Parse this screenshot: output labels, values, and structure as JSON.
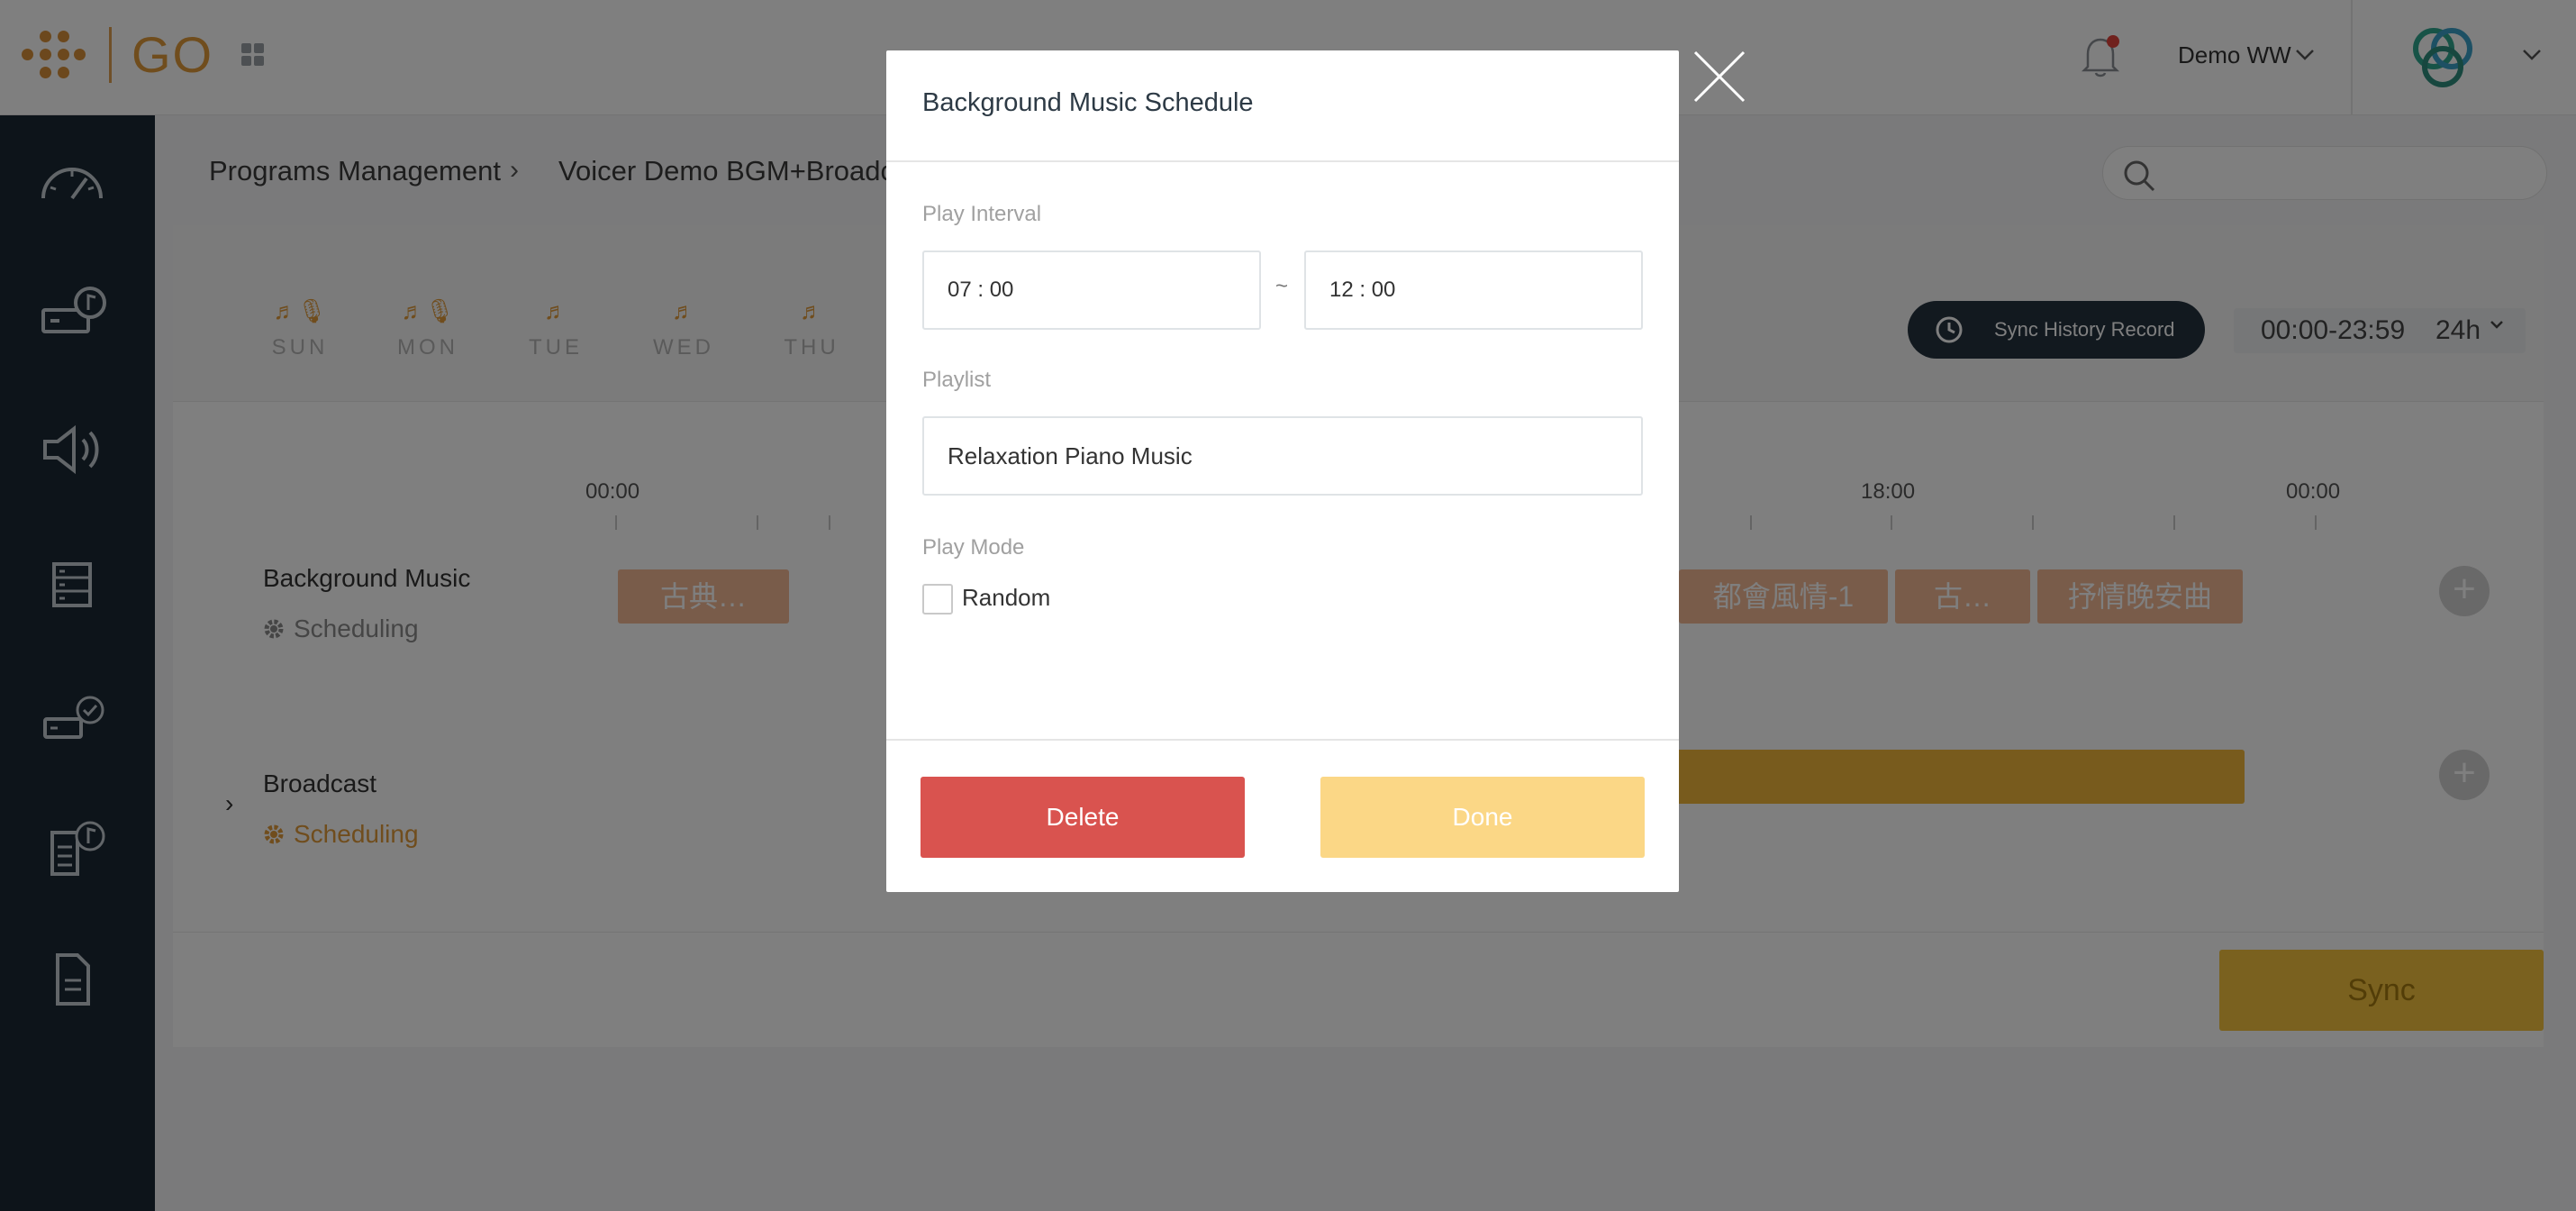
{
  "header": {
    "logo_text": "GO",
    "user_name": "Demo WW"
  },
  "breadcrumb": {
    "level1": "Programs Management",
    "level2": "Voicer Demo BGM+Broadcast"
  },
  "days": [
    {
      "label": "SUN",
      "icons": "♬🎙"
    },
    {
      "label": "MON",
      "icons": "♬🎙"
    },
    {
      "label": "TUE",
      "icons": "♬"
    },
    {
      "label": "WED",
      "icons": "♬"
    },
    {
      "label": "THU",
      "icons": "♬"
    }
  ],
  "toolbar": {
    "sync_history_label": "Sync History Record",
    "time_range": "00:00-23:59",
    "time_mode": "24h"
  },
  "timeline": {
    "tick_labels": [
      "00:00",
      "18:00",
      "00:00"
    ]
  },
  "rows": {
    "bgm": {
      "title": "Background Music",
      "status": "Scheduling"
    },
    "broadcast": {
      "title": "Broadcast",
      "status": "Scheduling"
    }
  },
  "bgm_blocks": [
    "古典…",
    "都會風情-1",
    "古…",
    "抒情晚安曲"
  ],
  "sync_button": "Sync",
  "modal": {
    "title": "Background Music Schedule",
    "play_interval_label": "Play Interval",
    "start_time": "07 : 00",
    "separator": "~",
    "end_time": "12 : 00",
    "playlist_label": "Playlist",
    "playlist_value": "Relaxation Piano Music",
    "play_mode_label": "Play Mode",
    "random_label": "Random",
    "random_checked": false,
    "delete_label": "Delete",
    "done_label": "Done"
  },
  "colors": {
    "accent_orange": "#e09a3a",
    "sidebar_bg": "#1b2835",
    "delete_red": "#d9534f",
    "done_yellow": "#fbd786"
  }
}
